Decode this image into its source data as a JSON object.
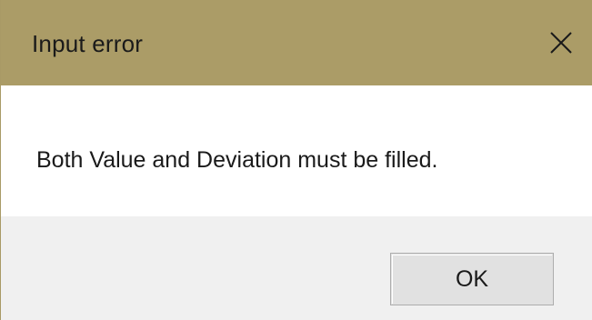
{
  "dialog": {
    "title": "Input error",
    "message": "Both Value and Deviation must be filled.",
    "ok_label": "OK",
    "close_icon": "close-icon"
  },
  "colors": {
    "titlebar": "#ab9c67",
    "content_bg": "#ffffff",
    "footer_bg": "#f0f0f0",
    "button_bg": "#e1e1e1"
  }
}
